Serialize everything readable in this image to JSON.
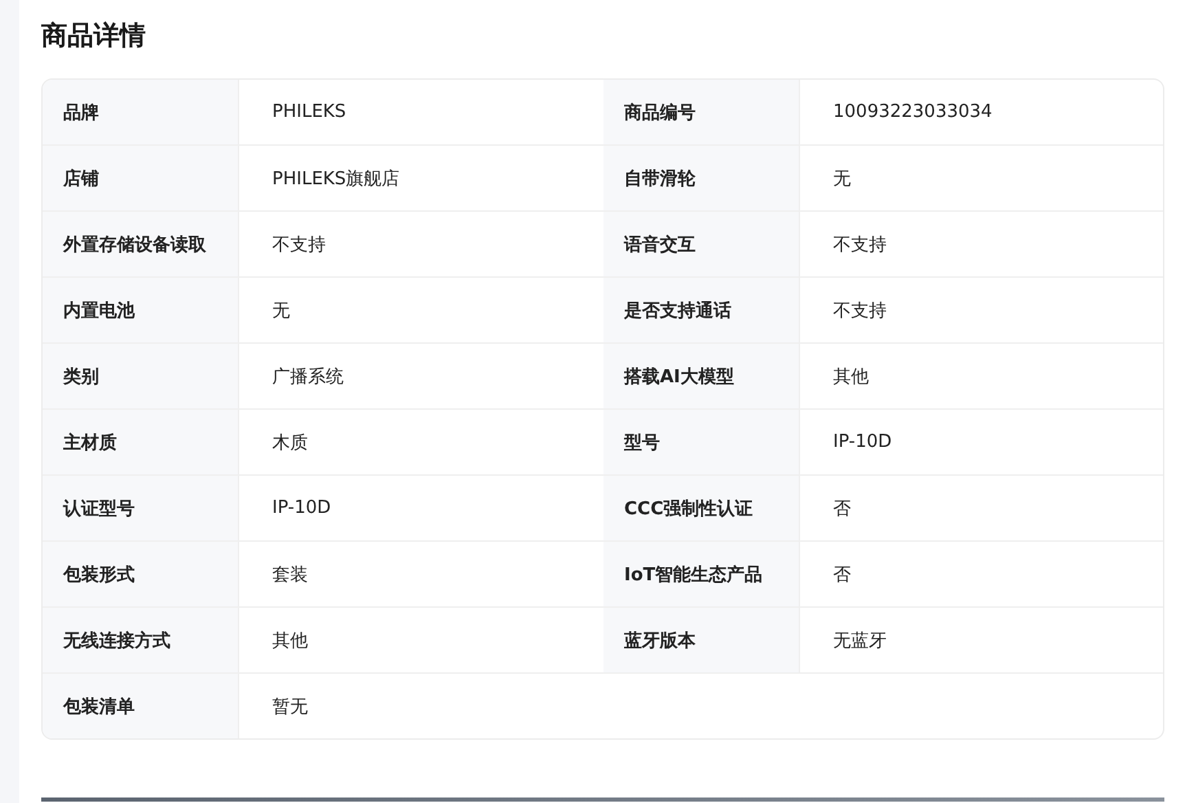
{
  "title": "商品详情",
  "specs": [
    {
      "label": "品牌",
      "value": "PHILEKS"
    },
    {
      "label": "商品编号",
      "value": "10093223033034"
    },
    {
      "label": "店铺",
      "value": "PHILEKS旗舰店"
    },
    {
      "label": "自带滑轮",
      "value": "无"
    },
    {
      "label": "外置存储设备读取",
      "value": "不支持"
    },
    {
      "label": "语音交互",
      "value": "不支持"
    },
    {
      "label": "内置电池",
      "value": "无"
    },
    {
      "label": "是否支持通话",
      "value": "不支持"
    },
    {
      "label": "类别",
      "value": "广播系统"
    },
    {
      "label": "搭载AI大模型",
      "value": "其他"
    },
    {
      "label": "主材质",
      "value": "木质"
    },
    {
      "label": "型号",
      "value": "IP-10D"
    },
    {
      "label": "认证型号",
      "value": "IP-10D"
    },
    {
      "label": "CCC强制性认证",
      "value": "否"
    },
    {
      "label": "包装形式",
      "value": "套装"
    },
    {
      "label": "IoT智能生态产品",
      "value": "否"
    },
    {
      "label": "无线连接方式",
      "value": "其他"
    },
    {
      "label": "蓝牙版本",
      "value": "无蓝牙"
    },
    {
      "label": "包装清单",
      "value": "暂无"
    }
  ]
}
